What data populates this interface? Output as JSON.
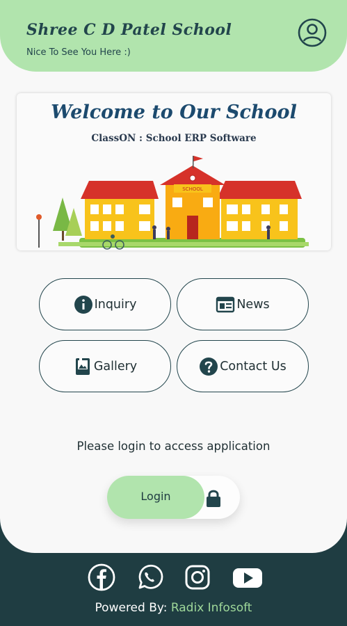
{
  "header": {
    "school_name": "Shree C D Patel School",
    "greeting": "Nice To See You Here :)",
    "profile_icon": "account-circle-icon"
  },
  "banner": {
    "title": "Welcome to Our School",
    "subtitle": "ClassON : School ERP Software",
    "building_sign": "SCHOOL"
  },
  "menu": [
    {
      "label": "Inquiry",
      "icon": "info-icon"
    },
    {
      "label": "News",
      "icon": "news-icon"
    },
    {
      "label": "Gallery",
      "icon": "gallery-icon"
    },
    {
      "label": "Contact Us",
      "icon": "help-icon"
    }
  ],
  "notice": "Please login to access application",
  "login": {
    "label": "Login",
    "icon": "lock-icon"
  },
  "footer": {
    "socials": [
      "facebook-icon",
      "whatsapp-icon",
      "instagram-icon",
      "youtube-icon"
    ],
    "powered_prefix": "Powered By: ",
    "powered_brand": "Radix Infosoft"
  },
  "colors": {
    "accent_green": "#b1e4ad",
    "dark_teal": "#1f3d42",
    "page_bg": "#f8f8f8"
  }
}
